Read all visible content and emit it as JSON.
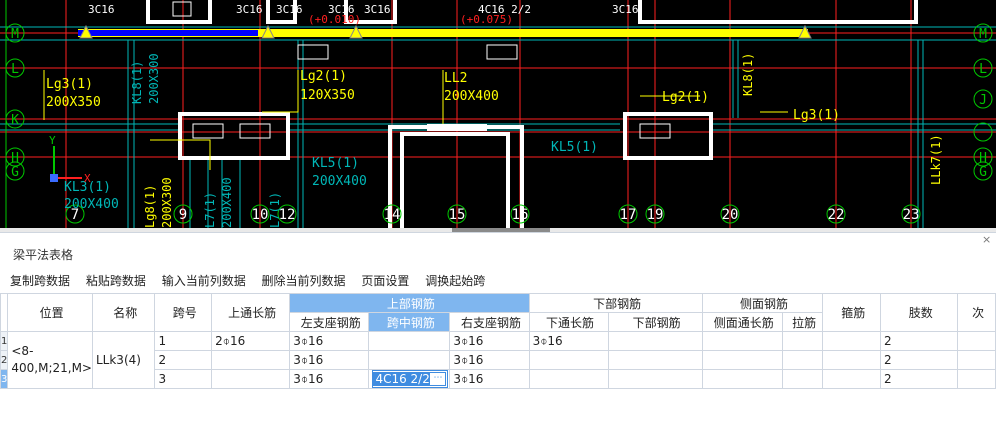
{
  "cad": {
    "top_labels": [
      "3C16",
      "3C16",
      "3C16",
      "3C16",
      "3C16",
      "4C16 2/2",
      "3C16"
    ],
    "elevations": [
      "(+0.010)",
      "(+0.075)"
    ],
    "axis_labels_right": [
      "M",
      "L",
      "J",
      "H",
      "G"
    ],
    "axis_labels_left": [
      "M",
      "L",
      "K",
      "H",
      "G"
    ],
    "bottom_axes": [
      "7",
      "9",
      "10",
      "12",
      "14",
      "15",
      "16",
      "17",
      "19",
      "20",
      "22",
      "23"
    ],
    "beam_labels": [
      "Lg3(1)",
      "200X350",
      "KL8(1)",
      "200X300",
      "Lg2(1)",
      "120X350",
      "LL2",
      "200X400",
      "Lg2(1)",
      "KL8(1)",
      "Lg3(1)",
      "KL5(1)",
      "200X400",
      "KL5(1)",
      "LLk7(1)",
      "KL3(1)",
      "200X400",
      "Lg8(1)",
      "200X300",
      "L7(1)",
      "200X400",
      "L7(1)"
    ],
    "ucs": [
      "Y",
      "X"
    ]
  },
  "panel": {
    "title": "梁平法表格",
    "close": "×",
    "toolbar": [
      "复制跨数据",
      "粘贴跨数据",
      "输入当前列数据",
      "删除当前列数据",
      "页面设置",
      "调换起始跨"
    ]
  },
  "table": {
    "headers": {
      "position": "位置",
      "name": "名称",
      "span": "跨号",
      "top_long": "上通长筋",
      "upper_group": "上部钢筋",
      "left_support": "左支座钢筋",
      "mid_span": "跨中钢筋",
      "right_support": "右支座钢筋",
      "lower_group": "下部钢筋",
      "bottom_long": "下通长筋",
      "bottom_bar": "下部钢筋",
      "side_group": "侧面钢筋",
      "side_long": "侧面通长筋",
      "tie": "拉筋",
      "stirrup": "箍筋",
      "legs": "肢数",
      "next": "次"
    },
    "position_value": "<8-400,M;21,M>",
    "name_value": "LLk3(4)",
    "rows": [
      {
        "rownum": "1",
        "span": "1",
        "top_long": "2⌽16",
        "left": "3⌽16",
        "mid": "",
        "right": "3⌽16",
        "bottom_long": "3⌽16",
        "legs": "2"
      },
      {
        "rownum": "2",
        "span": "2",
        "top_long": "",
        "left": "3⌽16",
        "mid": "",
        "right": "3⌽16",
        "bottom_long": "",
        "legs": "2"
      },
      {
        "rownum": "3",
        "span": "3",
        "top_long": "",
        "left": "3⌽16",
        "mid": "4C16 2/2",
        "right": "3⌽16",
        "bottom_long": "",
        "legs": "2"
      }
    ],
    "editor_button": "⋯"
  },
  "colors": {
    "cad_bg": "#000000",
    "wall": "#ffffff",
    "beam_cyan": "#00b7b7",
    "beam_yellow": "#ffff00",
    "axis_red": "#ff2020",
    "selected_beam": "#0000ff",
    "header_highlight": "#7fb6ef"
  }
}
